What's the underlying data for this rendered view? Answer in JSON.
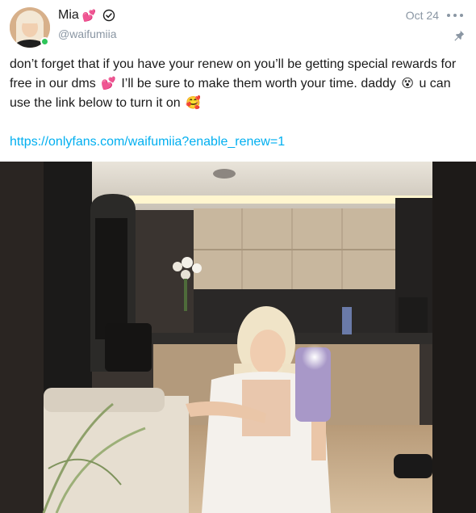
{
  "post": {
    "author": {
      "display_name": "Mia",
      "name_emoji": "💕",
      "username": "@waifumiia",
      "verified": true,
      "online": true
    },
    "date": "Oct 24",
    "icons": {
      "more": "more-horizontal-icon",
      "pin": "pin-icon",
      "verified": "verified-badge-icon"
    },
    "text": {
      "part1": "don’t forget that if you have your renew on you’ll be getting special rewards for free in our dms",
      "emoji1": "💕",
      "part2": "I’ll be sure to make them worth your time. daddy",
      "emoji2": "😵",
      "part3": "u can use the link below to turn it on",
      "emoji3": "🥰"
    },
    "link": "https://onlyfans.com/waifumiia?enable_renew=1"
  },
  "colors": {
    "link": "#00aff0",
    "muted": "#8a96a3",
    "online": "#2ec55a",
    "heart": "#ff3c86"
  }
}
